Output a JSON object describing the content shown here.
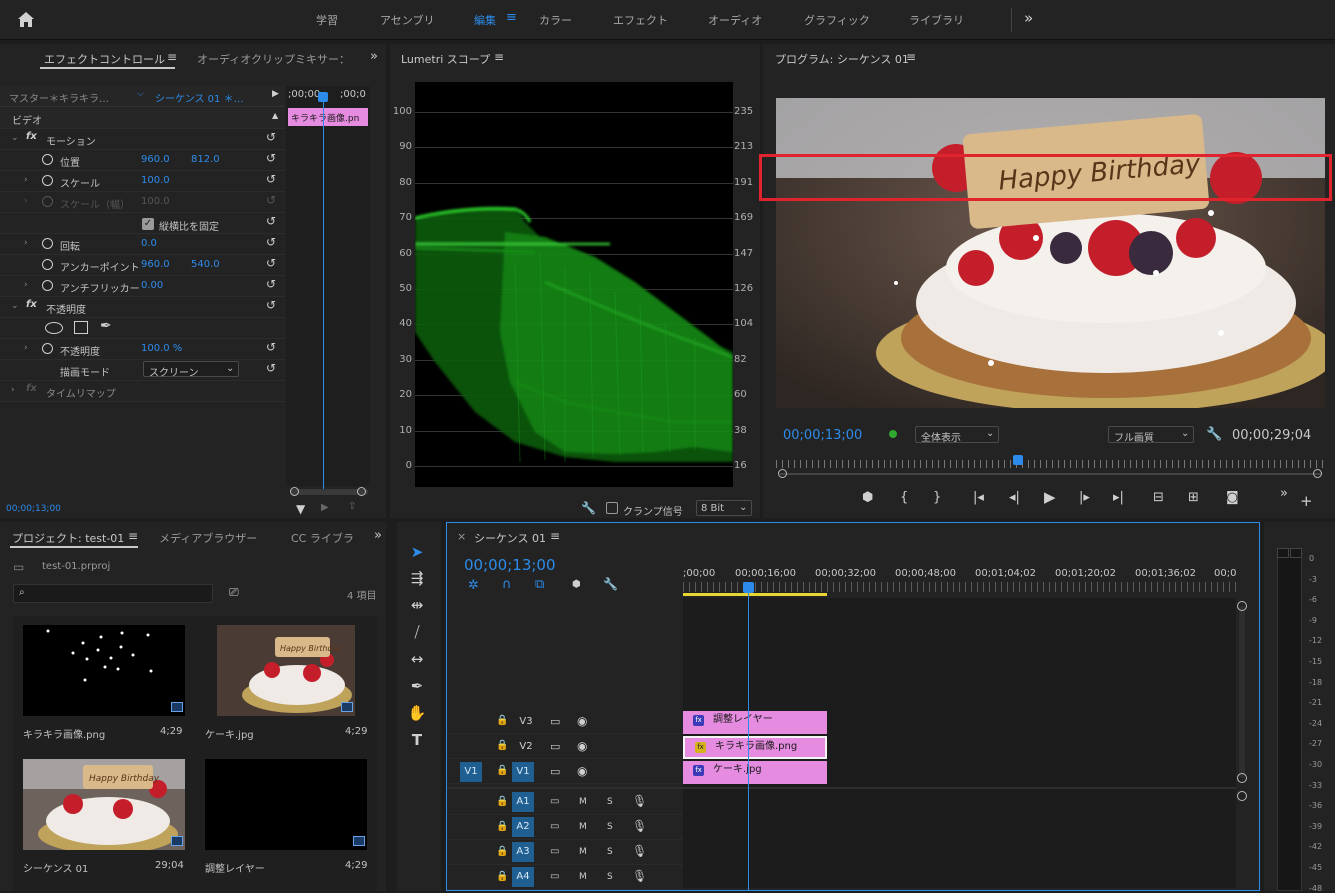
{
  "topbar": {
    "workspaces": [
      "学習",
      "アセンブリ",
      "編集",
      "カラー",
      "エフェクト",
      "オーディオ",
      "グラフィック",
      "ライブラリ"
    ],
    "active": "編集",
    "more": "»"
  },
  "effects": {
    "tab_active": "エフェクトコントロール",
    "tab_other": "オーディオクリップミキサー：シ",
    "master_label": "マスター＊キラキラ…",
    "sequence_label": "シーケンス 01 ＊…",
    "ruler_start": ";00;00",
    "ruler_mid": ";00;0",
    "clip_name": "キラキラ画像.pn",
    "video_header": "ビデオ",
    "motion": "モーション",
    "position_label": "位置",
    "position_x": "960.0",
    "position_y": "812.0",
    "scale_label": "スケール",
    "scale_value": "100.0",
    "scale_width_label": "スケール（幅）",
    "scale_width_value": "100.0",
    "uniform_scale": "縦横比を固定",
    "rotation_label": "回転",
    "rotation_value": "0.0",
    "anchor_label": "アンカーポイント",
    "anchor_x": "960.0",
    "anchor_y": "540.0",
    "antiflicker_label": "アンチフリッカー",
    "antiflicker_value": "0.00",
    "opacity_section": "不透明度",
    "opacity_label": "不透明度",
    "opacity_value": "100.0 %",
    "blend_label": "描画モード",
    "blend_value": "スクリーン",
    "time_remap": "タイムリマップ",
    "timecode": "00;00;13;00"
  },
  "scope": {
    "title": "Lumetri スコープ",
    "left_ticks": [
      "100",
      "90",
      "80",
      "70",
      "60",
      "50",
      "40",
      "30",
      "20",
      "10",
      "0"
    ],
    "right_ticks": [
      "235",
      "213",
      "191",
      "169",
      "147",
      "126",
      "104",
      "82",
      "60",
      "38",
      "16"
    ],
    "clamp_label": "クランプ信号",
    "bit_value": "8 Bit"
  },
  "program": {
    "title": "プログラム: シーケンス 01",
    "cake_text": "Happy Birthday",
    "current_tc": "00;00;13;00",
    "fit_value": "全体表示",
    "quality_value": "フル画質",
    "duration_tc": "00;00;29;04"
  },
  "project": {
    "tab_active": "プロジェクト: test-01",
    "tab_media": "メディアブラウザー",
    "tab_cc": "CC ライブラ",
    "file_name": "test-01.prproj",
    "item_count": "4 項目",
    "items": [
      {
        "name": "キラキラ画像.png",
        "duration": "4;29"
      },
      {
        "name": "ケーキ.jpg",
        "duration": "4;29"
      },
      {
        "name": "シーケンス 01",
        "duration": "29;04"
      },
      {
        "name": "調整レイヤー",
        "duration": "4;29"
      }
    ],
    "thumb_text": "Happy Birthday"
  },
  "timeline": {
    "tab_title": "シーケンス 01",
    "close": "×",
    "timecode": "00;00;13;00",
    "ruler": [
      ";00;00",
      "00;00;16;00",
      "00;00;32;00",
      "00;00;48;00",
      "00;01;04;02",
      "00;01;20;02",
      "00;01;36;02",
      "00;0"
    ],
    "video_tracks": [
      {
        "name": "V3",
        "clip": "調整レイヤー"
      },
      {
        "name": "V2",
        "clip": "キラキラ画像.png"
      },
      {
        "name": "V1",
        "clip": "ケーキ.jpg",
        "source": "V1"
      }
    ],
    "audio_tracks": [
      "A1",
      "A2",
      "A3",
      "A4"
    ],
    "m_label": "M",
    "s_label": "S"
  },
  "meter": {
    "labels": [
      "0",
      "-3",
      "-6",
      "-9",
      "-12",
      "-15",
      "-18",
      "-21",
      "-24",
      "-27",
      "-30",
      "-33",
      "-36",
      "-39",
      "-42",
      "-45",
      "-48"
    ]
  },
  "colors": {
    "accent_blue": "#2d8ceb",
    "clip_pink": "#e58be0",
    "highlight_red": "#e0242e",
    "scope_green": "#1fbf1f"
  }
}
